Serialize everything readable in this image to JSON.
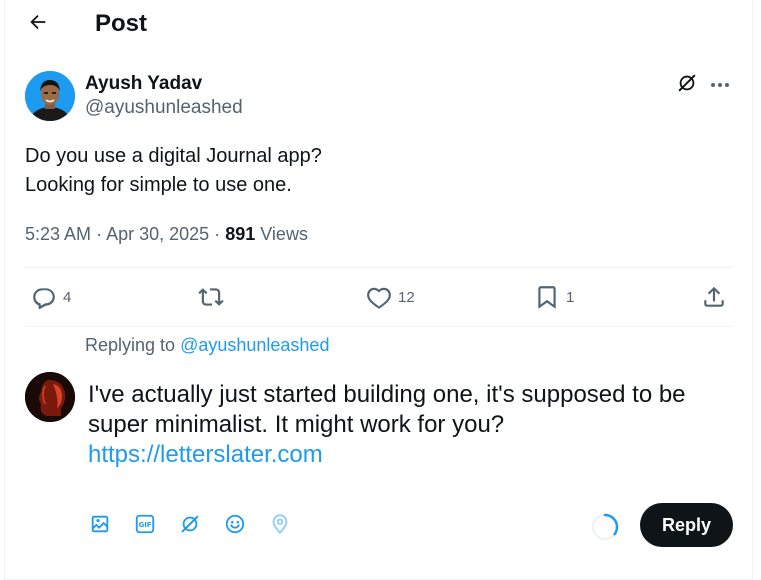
{
  "header": {
    "title": "Post"
  },
  "post": {
    "author_name": "Ayush Yadav",
    "author_handle": "@ayushunleashed",
    "text_lines": [
      "Do you use a digital Journal app?",
      "Looking for simple to use one."
    ],
    "time": "5:23 AM",
    "separator": "·",
    "date": "Apr 30, 2025",
    "views_count": "891",
    "views_label": "Views"
  },
  "actions": {
    "replies": "4",
    "likes": "12",
    "bookmarks": "1"
  },
  "composer": {
    "replying_prefix": "Replying to",
    "replying_handle": "@ayushunleashed",
    "draft_text": "I've actually just started building one, it's supposed to be super minimalist. It might work for you?",
    "draft_link": "https://letterslater.com",
    "reply_button": "Reply",
    "char_progress": 0.35
  },
  "colors": {
    "accent": "#1d9bf0",
    "text": "#0f1419",
    "muted": "#536471",
    "button_bg": "#0f1419"
  },
  "icons": {
    "back": "arrow-left-icon",
    "grok": "grok-icon",
    "more": "more-horizontal-icon",
    "reply": "reply-icon",
    "repost": "repost-icon",
    "like": "heart-icon",
    "bookmark": "bookmark-icon",
    "share": "share-icon",
    "media": "image-icon",
    "gif": "gif-icon",
    "grok_tool": "grok-icon",
    "emoji": "emoji-icon",
    "location": "location-icon"
  }
}
